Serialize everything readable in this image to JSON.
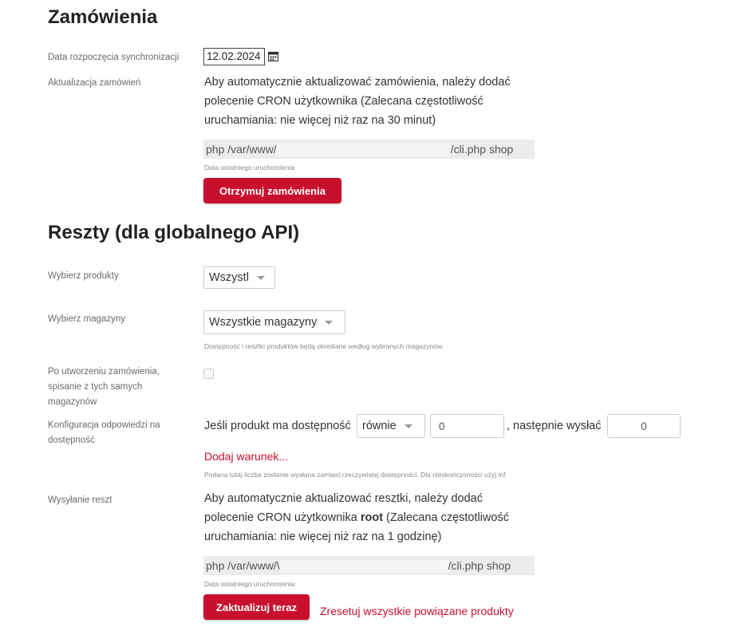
{
  "orders": {
    "title": "Zamówienia",
    "sync_start_label": "Data rozpoczęcia synchronizacji",
    "sync_start_value": "12.02.2024",
    "update_label": "Aktualizacja zamówień",
    "update_text": "Aby automatycznie aktualizować zamówienia, należy dodać polecenie CRON użytkownika (Zalecana częstotliwość uruchamiania: nie więcej niż raz na 30 minut)",
    "cron_prefix": "php /var/www/",
    "cron_suffix": "/cli.php shop",
    "last_run_label": "Data ostatniego uruchomienia:",
    "fetch_button": "Otrzymuj zamówienia"
  },
  "stocks": {
    "title": "Reszty (dla globalnego API)",
    "products_label": "Wybierz produkty",
    "products_value": "Wszystl",
    "warehouses_label": "Wybierz magazyny",
    "warehouses_value": "Wszystkie magazyny",
    "warehouses_hint": "Dostępność i resztki produktów będą określane według wybranych magazynów.",
    "writeoff_label": "Po utworzeniu zamówienia, spisanie z tych samych magazynów",
    "writeoff_checked": false,
    "config_label": "Konfiguracja odpowiedzi na dostępność",
    "cond_prefix": "Jeśli produkt ma dostępność",
    "cond_operator": "równie",
    "cond_value": "0",
    "cond_then": ", następnie wysłać",
    "cond_send_value": "0",
    "add_condition": "Dodaj warunek...",
    "config_hint": "Podana tutaj liczba zostanie wysłana zamiast rzeczywistej dostępności. Dla nieskończoności użyj inf",
    "send_label": "Wysyłanie reszt",
    "send_text_1": "Aby automatycznie aktualizować resztki, należy dodać polecenie CRON użytkownika ",
    "send_user": "root",
    "send_text_2": " (Zalecana częstotliwość uruchamiania: nie więcej niż raz na 1 godzinę)",
    "cron_prefix": "php /var/www/\\",
    "cron_suffix": "/cli.php shop",
    "last_run_label": "Data ostatniego uruchomienia:",
    "update_button": "Zaktualizuj teraz",
    "reset_link": "Zresetuj wszystkie powiązane produkty"
  },
  "icons": {
    "calendar": "calendar-icon",
    "dropdown": "caret-down-icon"
  },
  "colors": {
    "accent": "#c8102e",
    "command_bg": "#ececec"
  }
}
